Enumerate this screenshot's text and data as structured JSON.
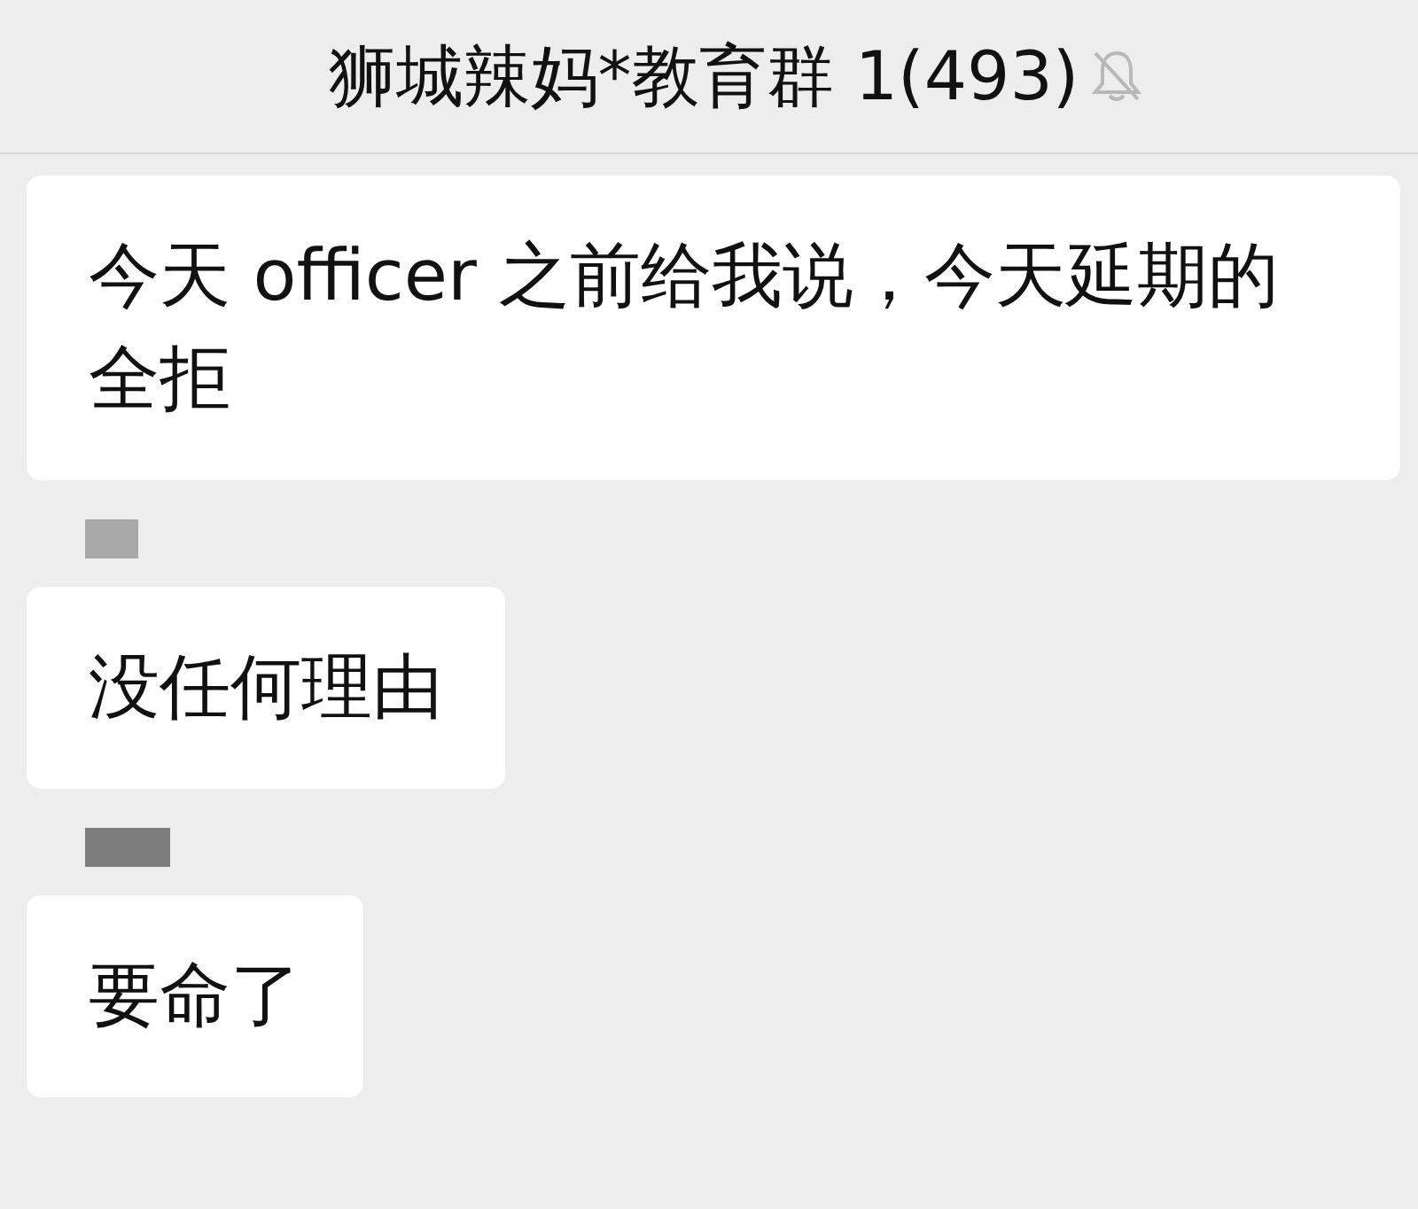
{
  "header": {
    "title": "狮城辣妈*教育群 1(493)",
    "muted": true
  },
  "messages": [
    {
      "text": "今天 officer 之前给我说，今天延期的全拒",
      "sender_redacted": false
    },
    {
      "text": "没任何理由",
      "sender_redacted": true
    },
    {
      "text": "要命了",
      "sender_redacted": true
    }
  ]
}
